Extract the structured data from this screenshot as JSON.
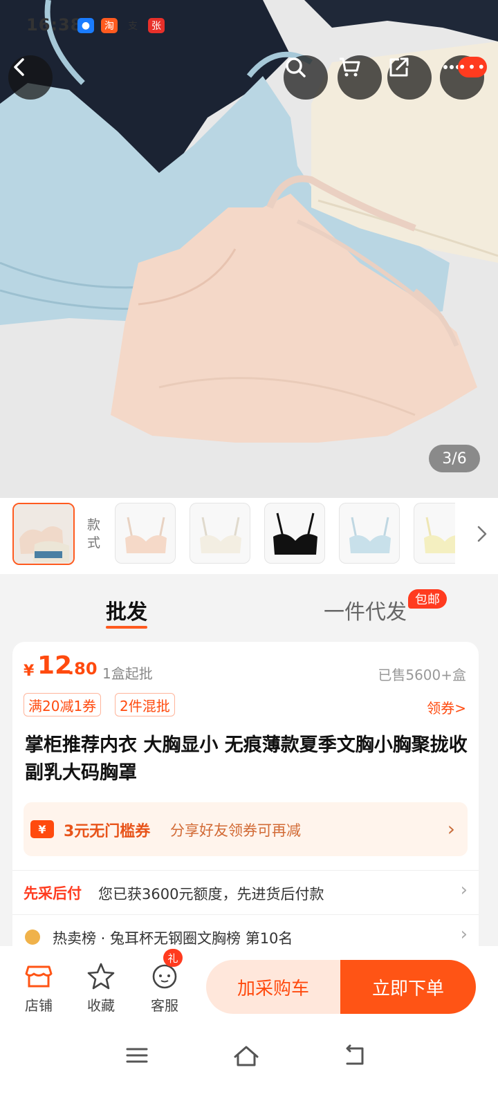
{
  "status_bar": {
    "time": "16:38",
    "icons": [
      "qq-icon",
      "taobao-icon",
      "alipay-icon",
      "zhang-icon"
    ]
  },
  "hero": {
    "counter": "3/6"
  },
  "nav_buttons": [
    "back-icon",
    "search-icon",
    "cart-icon",
    "share-icon",
    "more-icon"
  ],
  "variants": {
    "label": "款式"
  },
  "tabs": [
    {
      "label": "批发",
      "active": true
    },
    {
      "label": "一件代发",
      "active": false,
      "badge": "包邮"
    }
  ],
  "product": {
    "price_symbol": "¥",
    "price_int": "12",
    "price_dec": ".80",
    "min_order": "1盒起批",
    "sold": "已售5600+盒",
    "tags": [
      "满20减1券",
      "2件混批"
    ],
    "coupon_link": "领券>",
    "title": "掌柜推荐内衣 大胸显小 无痕薄款夏季文胸小胸聚拢收副乳大码胸罩",
    "promo_main": "3元无门槛券",
    "promo_sub": "分享好友领券可再减",
    "credit_label": "先采后付",
    "credit_text": "您已获3600元额度，先进货后付款",
    "rank_text": "热卖榜 · 兔耳杯无钢圈文胸榜  第10名"
  },
  "bottom_bar": {
    "shop": "店铺",
    "favorite": "收藏",
    "service": "客服",
    "gift_badge": "礼",
    "add_cart": "加采购车",
    "buy_now": "立即下单"
  },
  "colors": {
    "accent": "#ff5415",
    "accent_light": "#ffe7db",
    "badge_red": "#ff3b1f"
  }
}
